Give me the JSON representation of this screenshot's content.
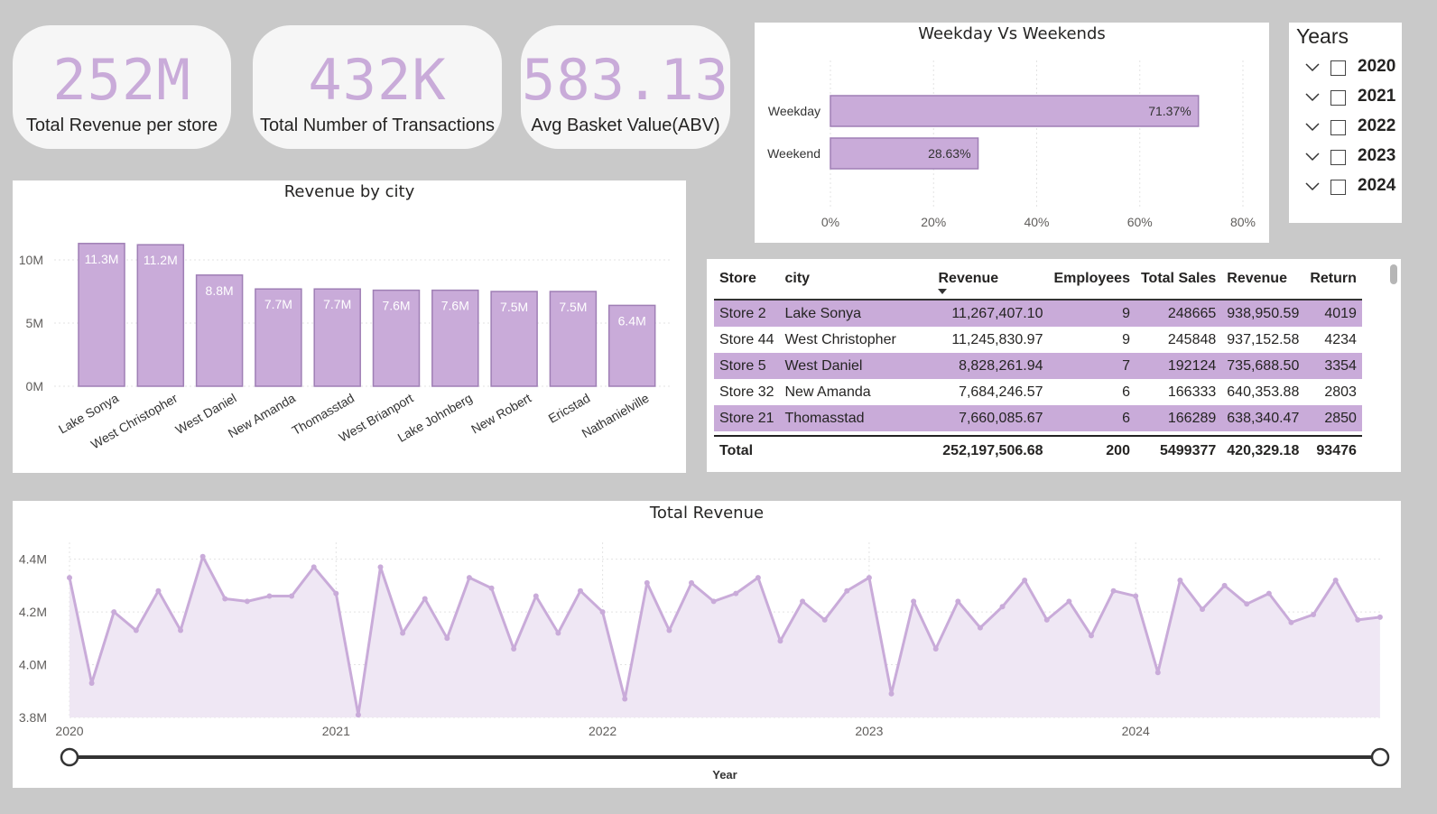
{
  "kpis": [
    {
      "value": "252M",
      "label": "Total Revenue per store"
    },
    {
      "value": "432K",
      "label": "Total Number of Transactions"
    },
    {
      "value": "583.13",
      "label": "Avg Basket Value(ABV)"
    }
  ],
  "colors": {
    "accent": "#c9abd9",
    "accent_border": "#9f7fb5",
    "line": "#c9abd9",
    "area": "#efe7f4",
    "background": "#c9c9c9"
  },
  "years_slicer": {
    "title": "Years",
    "items": [
      {
        "label": "2020",
        "icon": "chevron-down-icon",
        "checked": false
      },
      {
        "label": "2021",
        "icon": "chevron-down-icon",
        "checked": false
      },
      {
        "label": "2022",
        "icon": "chevron-down-icon",
        "checked": false
      },
      {
        "label": "2023",
        "icon": "chevron-down-icon",
        "checked": false
      },
      {
        "label": "2024",
        "icon": "chevron-down-icon",
        "checked": false
      }
    ]
  },
  "store_table": {
    "headers": [
      "Store",
      "city",
      "Revenue",
      "Employees",
      "Total Sales",
      "Revenue",
      "Return"
    ],
    "sort_icon": "sort-descending-icon",
    "rows": [
      [
        "Store 2",
        "Lake Sonya",
        "11,267,407.10",
        "9",
        "248665",
        "938,950.59",
        "4019"
      ],
      [
        "Store 44",
        "West Christopher",
        "11,245,830.97",
        "9",
        "245848",
        "937,152.58",
        "4234"
      ],
      [
        "Store 5",
        "West Daniel",
        "8,828,261.94",
        "7",
        "192124",
        "735,688.50",
        "3354"
      ],
      [
        "Store 32",
        "New Amanda",
        "7,684,246.57",
        "6",
        "166333",
        "640,353.88",
        "2803"
      ],
      [
        "Store 21",
        "Thomasstad",
        "7,660,085.67",
        "6",
        "166289",
        "638,340.47",
        "2850"
      ]
    ],
    "total": [
      "Total",
      "",
      "252,197,506.68",
      "200",
      "5499377",
      "420,329.18",
      "93476"
    ]
  },
  "chart_data": [
    {
      "type": "bar",
      "orientation": "horizontal",
      "title": "Weekday Vs Weekends",
      "categories": [
        "Weekday",
        "Weekend"
      ],
      "values": [
        71.37,
        28.63
      ],
      "data_labels": [
        "71.37%",
        "28.63%"
      ],
      "xlim": [
        0,
        80
      ],
      "x_ticks": [
        "0%",
        "20%",
        "40%",
        "60%",
        "80%"
      ],
      "grid": true
    },
    {
      "type": "bar",
      "title": "Revenue by city",
      "categories": [
        "Lake Sonya",
        "West Christopher",
        "West Daniel",
        "New Amanda",
        "Thomasstad",
        "West Brianport",
        "Lake Johnberg",
        "New Robert",
        "Ericstad",
        "Nathanielville"
      ],
      "values": [
        11.3,
        11.2,
        8.8,
        7.7,
        7.7,
        7.6,
        7.6,
        7.5,
        7.5,
        6.4
      ],
      "data_labels": [
        "11.3M",
        "11.2M",
        "8.8M",
        "7.7M",
        "7.7M",
        "7.6M",
        "7.6M",
        "7.5M",
        "7.5M",
        "6.4M"
      ],
      "ylim": [
        0,
        12
      ],
      "y_ticks": [
        {
          "value": 0,
          "label": "0M"
        },
        {
          "value": 5,
          "label": "5M"
        },
        {
          "value": 10,
          "label": "10M"
        }
      ],
      "grid": true
    },
    {
      "type": "area",
      "title": "Total Revenue",
      "xlabel": "Year",
      "x_ticks": [
        "2020",
        "2021",
        "2022",
        "2023",
        "2024"
      ],
      "ylim": [
        3.8,
        4.45
      ],
      "y_ticks": [
        {
          "value": 3.8,
          "label": "3.8M"
        },
        {
          "value": 4.0,
          "label": "4.0M"
        },
        {
          "value": 4.2,
          "label": "4.2M"
        },
        {
          "value": 4.4,
          "label": "4.4M"
        }
      ],
      "x_start": 2020,
      "points_per_year": 12,
      "values": [
        4.33,
        3.93,
        4.2,
        4.13,
        4.28,
        4.13,
        4.41,
        4.25,
        4.24,
        4.26,
        4.26,
        4.37,
        4.27,
        3.81,
        4.37,
        4.12,
        4.25,
        4.1,
        4.33,
        4.29,
        4.06,
        4.26,
        4.12,
        4.28,
        4.2,
        3.87,
        4.31,
        4.13,
        4.31,
        4.24,
        4.27,
        4.33,
        4.09,
        4.24,
        4.17,
        4.28,
        4.33,
        3.89,
        4.24,
        4.06,
        4.24,
        4.14,
        4.22,
        4.32,
        4.17,
        4.24,
        4.11,
        4.28,
        4.26,
        3.97,
        4.32,
        4.21,
        4.3,
        4.23,
        4.27,
        4.16,
        4.19,
        4.32,
        4.17,
        4.18
      ],
      "grid": true
    }
  ]
}
